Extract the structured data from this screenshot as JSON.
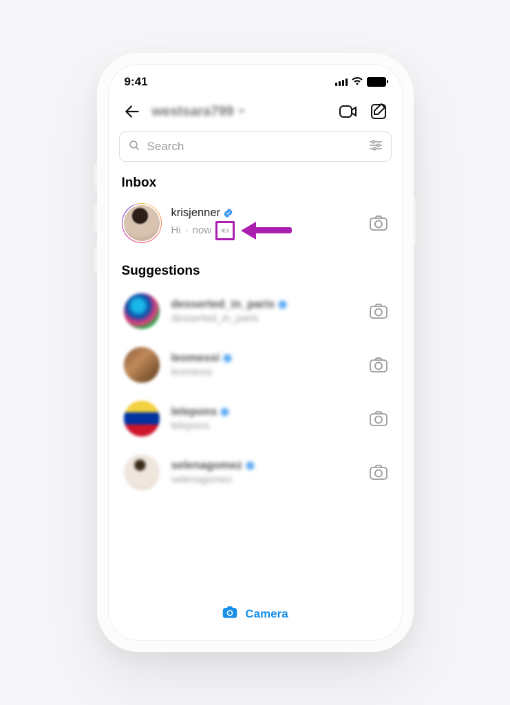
{
  "status": {
    "time": "9:41"
  },
  "nav": {
    "username": "westsara799"
  },
  "search": {
    "placeholder": "Search"
  },
  "sections": {
    "inbox": "Inbox",
    "suggestions": "Suggestions"
  },
  "inbox": {
    "username": "krisjenner",
    "preview": "Hi",
    "separator": "·",
    "time": "now"
  },
  "suggestions": [
    {
      "username": "desserted_in_paris",
      "sub": "desserted_in_paris"
    },
    {
      "username": "leomessi",
      "sub": "leomessi"
    },
    {
      "username": "lelepons",
      "sub": "lelepons"
    },
    {
      "username": "selenagomez",
      "sub": "selenagomez"
    }
  ],
  "footer": {
    "camera": "Camera"
  }
}
